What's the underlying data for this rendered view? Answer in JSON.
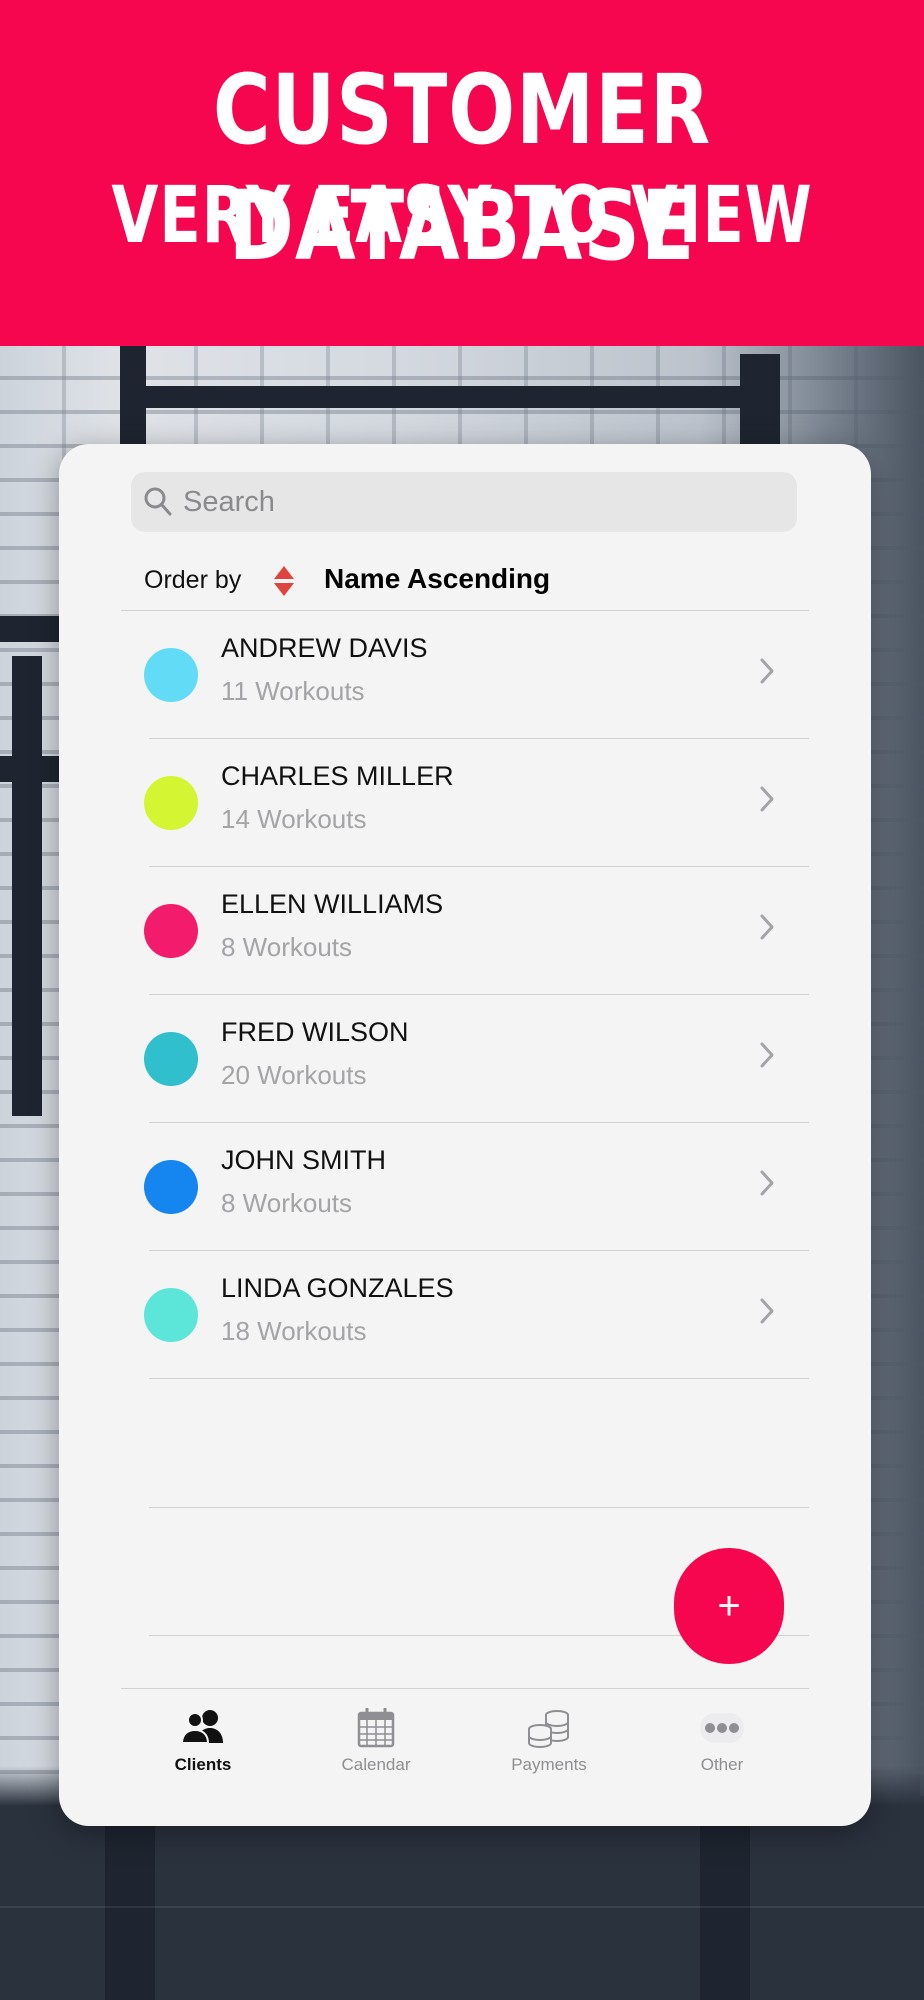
{
  "banner": {
    "line1": "CUSTOMER DATABASE",
    "line2": "VERY EASY TO VIEW"
  },
  "colors": {
    "brand": "#f5064f",
    "sort_arrows": "#e0443e"
  },
  "search": {
    "placeholder": "Search",
    "icon": "search-icon"
  },
  "order": {
    "label": "Order by",
    "icon": "sort-arrows-icon",
    "value": "Name Ascending"
  },
  "clients": [
    {
      "name": "ANDREW DAVIS",
      "workouts": "11 Workouts",
      "color": "#61dbf6"
    },
    {
      "name": "CHARLES MILLER",
      "workouts": "14 Workouts",
      "color": "#d4f531"
    },
    {
      "name": "ELLEN WILLIAMS",
      "workouts": "8 Workouts",
      "color": "#f31c6c"
    },
    {
      "name": "FRED WILSON",
      "workouts": "20 Workouts",
      "color": "#2fbfcd"
    },
    {
      "name": "JOHN SMITH",
      "workouts": "8 Workouts",
      "color": "#1586f0"
    },
    {
      "name": "LINDA GONZALES",
      "workouts": "18 Workouts",
      "color": "#5ce6d9"
    }
  ],
  "fab": {
    "label": "+"
  },
  "tabs": [
    {
      "label": "Clients",
      "icon": "people-icon",
      "active": true
    },
    {
      "label": "Calendar",
      "icon": "calendar-icon",
      "active": false
    },
    {
      "label": "Payments",
      "icon": "coins-icon",
      "active": false
    },
    {
      "label": "Other",
      "icon": "more-dots-icon",
      "active": false
    }
  ]
}
